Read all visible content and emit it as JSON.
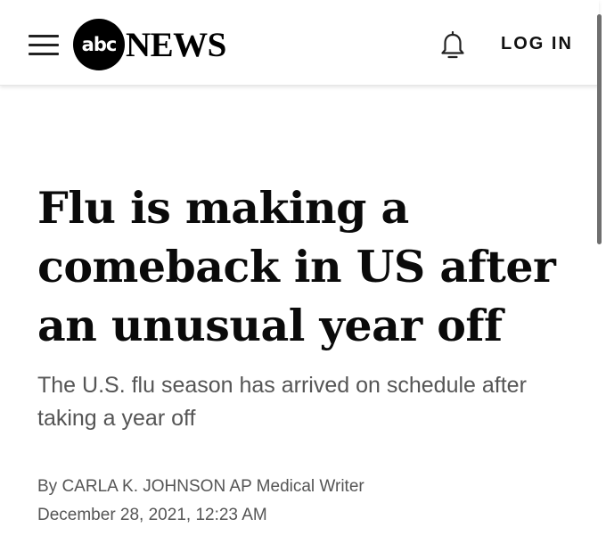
{
  "header": {
    "logo_mark": "abc",
    "logo_word": "NEWS",
    "login_label": "LOG IN",
    "icons": {
      "menu": "hamburger-menu-icon",
      "notifications": "bell-icon"
    }
  },
  "article": {
    "headline": "Flu is making a comeback in US after an unusual year off",
    "subheadline": "The U.S. flu season has arrived on schedule after taking a year off",
    "byline": "By CARLA K. JOHNSON AP Medical Writer",
    "date": "December 28, 2021, 12:23 AM"
  }
}
